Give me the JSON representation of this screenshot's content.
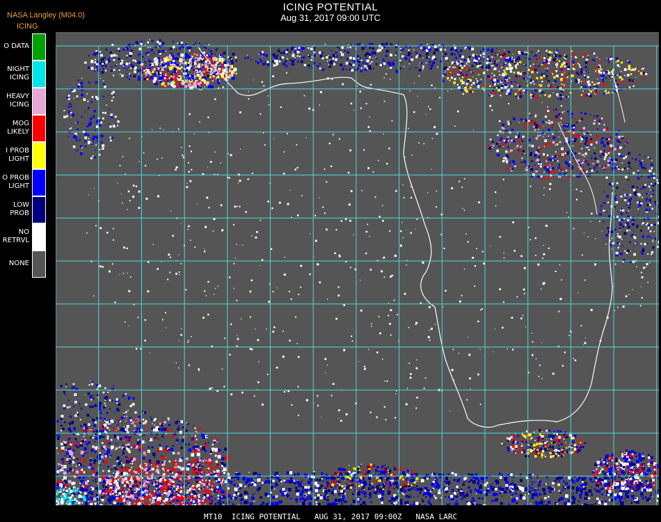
{
  "header": {
    "title": "ICING POTENTIAL",
    "datetime": "Aug 31, 2017 09:00 UTC",
    "source": "NASA Langley (M04.0)",
    "product": "ICING"
  },
  "legend": [
    {
      "label": "O DATA",
      "color": "#00a000"
    },
    {
      "label": "NIGHT\nICING",
      "color": "#00e6e6"
    },
    {
      "label": "HEAVY\nICING",
      "color": "#e6a8d8"
    },
    {
      "label": "MOG\nLIKELY",
      "color": "#ff0000"
    },
    {
      "label": "I PROB\nLIGHT",
      "color": "#ffff00"
    },
    {
      "label": "O PROB\nLIGHT",
      "color": "#0000ff"
    },
    {
      "label": "LOW\nPROB",
      "color": "#000080"
    },
    {
      "label": "NO\nRETRVL",
      "color": "#ffffff"
    },
    {
      "label": "NONE",
      "color": "#555555"
    }
  ],
  "map": {
    "background": "#555555",
    "grid_color": "#4fd8e0",
    "coast_color": "#ffffff",
    "label_color": "#c82020"
  },
  "footer": "MT10  ICING POTENTIAL   AUG 31, 2017 09:00Z   NASA LARC"
}
